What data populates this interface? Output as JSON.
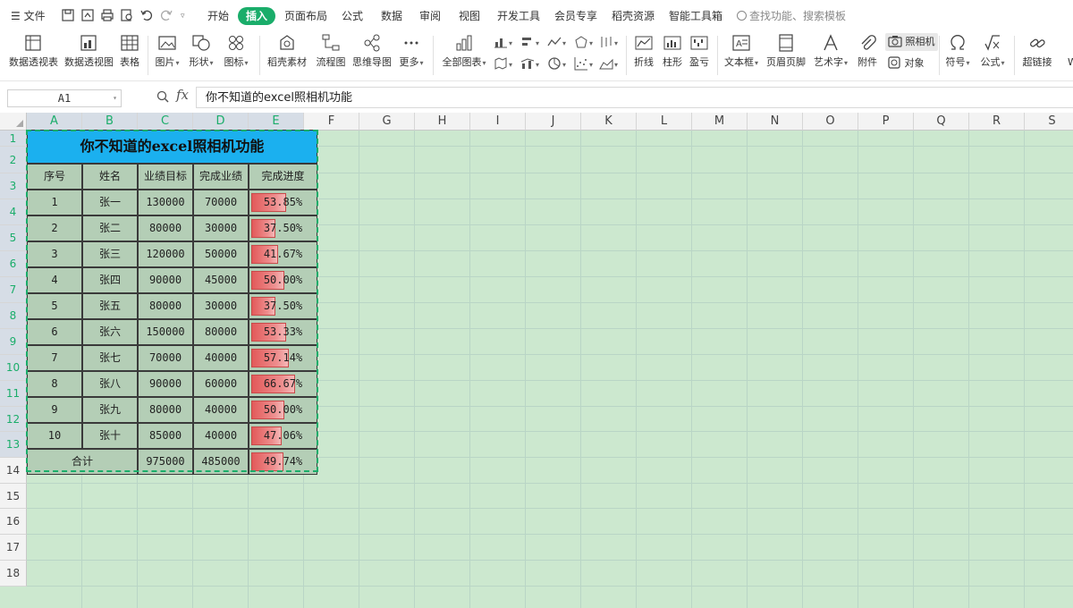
{
  "menubar": {
    "file_label": "文件",
    "tabs": [
      "开始",
      "插入",
      "页面布局",
      "公式",
      "数据",
      "审阅",
      "视图",
      "开发工具",
      "会员专享",
      "稻壳资源",
      "智能工具箱"
    ],
    "active_tab": "插入",
    "search_placeholder": "查找功能、搜索模板"
  },
  "ribbon": {
    "pivot_table": "数据透视表",
    "pivot_chart": "数据透视图",
    "table": "表格",
    "picture": "图片",
    "shape": "形状",
    "icon": "图标",
    "docer_material": "稻壳素材",
    "flowchart": "流程图",
    "mindmap": "思维导图",
    "more": "更多",
    "all_charts": "全部图表",
    "line_spark": "折线",
    "column_spark": "柱形",
    "winloss_spark": "盈亏",
    "textbox": "文本框",
    "header_footer": "页眉页脚",
    "wordart": "艺术字",
    "attachment": "附件",
    "camera": "照相机",
    "object": "对象",
    "symbol": "符号",
    "formula": "公式",
    "hyperlink": "超链接",
    "cut_off": "WI"
  },
  "formula_bar": {
    "cell_ref": "A1",
    "fx": "fx",
    "content": "你不知道的excel照相机功能"
  },
  "columns": [
    "A",
    "B",
    "C",
    "D",
    "E",
    "F",
    "G",
    "H",
    "I",
    "J",
    "K",
    "L",
    "M",
    "N",
    "O",
    "P",
    "Q",
    "R",
    "S"
  ],
  "rows": [
    "1",
    "2",
    "3",
    "4",
    "5",
    "6",
    "7",
    "8",
    "9",
    "10",
    "11",
    "12",
    "13",
    "14",
    "15",
    "16",
    "17",
    "18"
  ],
  "table": {
    "title": "你不知道的excel照相机功能",
    "headers": [
      "序号",
      "姓名",
      "业绩目标",
      "完成业绩",
      "完成进度"
    ],
    "rows": [
      {
        "no": "1",
        "name": "张一",
        "target": "130000",
        "done": "70000",
        "progress": "53.85%",
        "ratio": 0.5385
      },
      {
        "no": "2",
        "name": "张二",
        "target": "80000",
        "done": "30000",
        "progress": "37.50%",
        "ratio": 0.375
      },
      {
        "no": "3",
        "name": "张三",
        "target": "120000",
        "done": "50000",
        "progress": "41.67%",
        "ratio": 0.4167
      },
      {
        "no": "4",
        "name": "张四",
        "target": "90000",
        "done": "45000",
        "progress": "50.00%",
        "ratio": 0.5
      },
      {
        "no": "5",
        "name": "张五",
        "target": "80000",
        "done": "30000",
        "progress": "37.50%",
        "ratio": 0.375
      },
      {
        "no": "6",
        "name": "张六",
        "target": "150000",
        "done": "80000",
        "progress": "53.33%",
        "ratio": 0.5333
      },
      {
        "no": "7",
        "name": "张七",
        "target": "70000",
        "done": "40000",
        "progress": "57.14%",
        "ratio": 0.5714
      },
      {
        "no": "8",
        "name": "张八",
        "target": "90000",
        "done": "60000",
        "progress": "66.67%",
        "ratio": 0.6667
      },
      {
        "no": "9",
        "name": "张九",
        "target": "80000",
        "done": "40000",
        "progress": "50.00%",
        "ratio": 0.5
      },
      {
        "no": "10",
        "name": "张十",
        "target": "85000",
        "done": "40000",
        "progress": "47.06%",
        "ratio": 0.4706
      }
    ],
    "total": {
      "label": "合计",
      "target": "975000",
      "done": "485000",
      "progress": "49.74%",
      "ratio": 0.4974
    }
  },
  "colors": {
    "accent": "#1aad6a",
    "title_fill": "#1bb0ef",
    "cell_fill": "#b4ceb6",
    "sheet_bg": "#cce8cf",
    "bar": "#e25a5a"
  }
}
